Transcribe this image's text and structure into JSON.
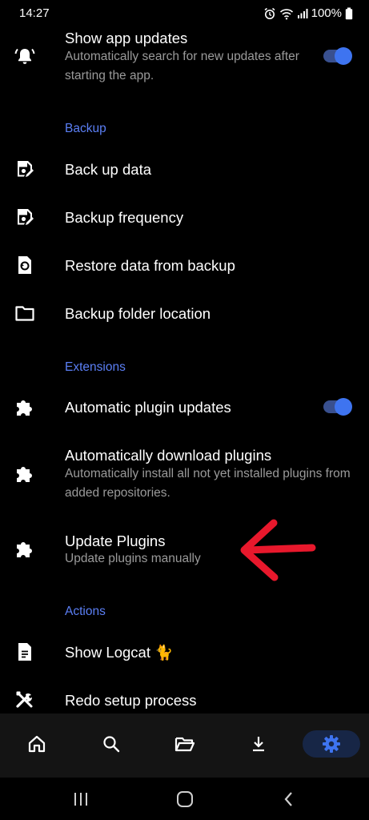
{
  "status": {
    "time": "14:27",
    "battery": "100%"
  },
  "settings": {
    "app_updates": {
      "title": "Show app updates",
      "subtitle": "Automatically search for new updates after starting the app.",
      "enabled": true
    },
    "backup_section": "Backup",
    "backup_items": [
      {
        "label": "Back up data",
        "icon": "backup-edit-icon"
      },
      {
        "label": "Backup frequency",
        "icon": "backup-edit-icon"
      },
      {
        "label": "Restore data from backup",
        "icon": "restore-icon"
      },
      {
        "label": "Backup folder location",
        "icon": "folder-icon"
      }
    ],
    "extensions_section": "Extensions",
    "auto_plugin_updates": {
      "title": "Automatic plugin updates",
      "enabled": true
    },
    "auto_download_plugins": {
      "title": "Automatically download plugins",
      "subtitle": "Automatically install all not yet installed plugins from added repositories."
    },
    "update_plugins": {
      "title": "Update Plugins",
      "subtitle": "Update plugins manually"
    },
    "actions_section": "Actions",
    "show_logcat": {
      "title": "Show Logcat 🐈"
    },
    "redo_setup": {
      "title": "Redo setup process"
    }
  },
  "bottom_nav": {
    "items": [
      "home-icon",
      "search-icon",
      "folder-open-icon",
      "download-icon",
      "gear-icon"
    ],
    "active": "gear-icon"
  },
  "colors": {
    "accent": "#5b7ff5",
    "toggle": "#3e74f0",
    "annotation_arrow": "#e8182c"
  }
}
